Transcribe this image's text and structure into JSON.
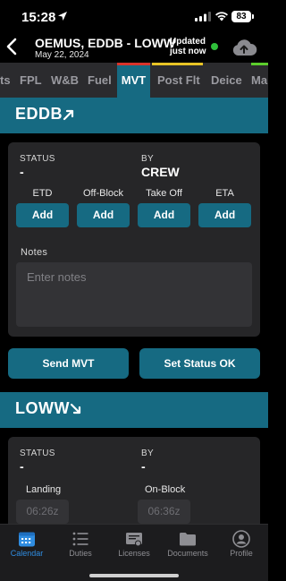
{
  "status_bar": {
    "time": "15:28",
    "battery": "83"
  },
  "header": {
    "title": "OEMUS, EDDB - LOWW",
    "date": "May 22, 2024",
    "updated_line1": "Updated",
    "updated_line2": "just now",
    "sync_status_color": "#2fbf3a"
  },
  "tabs": [
    {
      "label": "ts",
      "active": false
    },
    {
      "label": "FPL",
      "active": false
    },
    {
      "label": "W&B",
      "active": false
    },
    {
      "label": "Fuel",
      "active": false
    },
    {
      "label": "MVT",
      "active": true,
      "strip_color": "#d9342b"
    },
    {
      "label": "Post Flt",
      "active": false,
      "strip_color": "#e8c326"
    },
    {
      "label": "Deice",
      "active": false
    },
    {
      "label": "Ma",
      "active": false,
      "strip_color": "#5ccd2c"
    }
  ],
  "departure": {
    "code": "EDDB",
    "arrow_icon": "arrow-up-right-icon",
    "status_label": "STATUS",
    "status_value": "-",
    "by_label": "BY",
    "by_value": "CREW",
    "columns": [
      "ETD",
      "Off-Block",
      "Take Off",
      "ETA"
    ],
    "add_label": "Add",
    "notes_label": "Notes",
    "notes_placeholder": "Enter notes"
  },
  "actions": {
    "send_mvt": "Send MVT",
    "set_status_ok": "Set Status OK"
  },
  "arrival": {
    "code": "LOWW",
    "arrow_icon": "arrow-down-right-icon",
    "status_label": "STATUS",
    "status_value": "-",
    "by_label": "BY",
    "by_value": "-",
    "landing_label": "Landing",
    "landing_value": "06:26z",
    "onblock_label": "On-Block",
    "onblock_value": "06:36z"
  },
  "bottom_nav": [
    {
      "label": "Calendar",
      "icon": "calendar-icon",
      "active": true
    },
    {
      "label": "Duties",
      "icon": "list-icon",
      "active": false
    },
    {
      "label": "Licenses",
      "icon": "license-icon",
      "active": false
    },
    {
      "label": "Documents",
      "icon": "folder-icon",
      "active": false
    },
    {
      "label": "Profile",
      "icon": "profile-icon",
      "active": false
    }
  ],
  "colors": {
    "accent": "#166a82",
    "nav_active": "#2f8ce0"
  }
}
